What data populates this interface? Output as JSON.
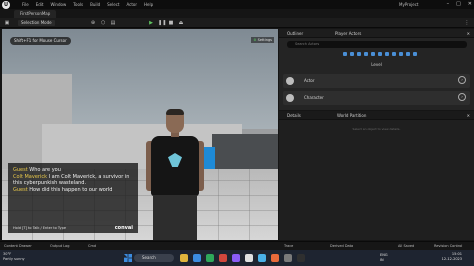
{
  "window": {
    "menu": [
      "File",
      "Edit",
      "Window",
      "Tools",
      "Build",
      "Select",
      "Actor",
      "Help"
    ],
    "project": "MyProject",
    "map_tab": "FirstPersonMap"
  },
  "toolbar": {
    "selection_mode": "Selection Mode"
  },
  "viewport": {
    "top_badge": "Shift+F1 for Mouse Cursor",
    "settings": "Settings",
    "chat": [
      {
        "speaker": "Guest",
        "text": "Who are you"
      },
      {
        "speaker": "Colt Maverick",
        "text": "I am Colt Maverick, a survivor in this cyberpunkish wasteland."
      },
      {
        "speaker": "Guest",
        "text": "How did this happen to our world"
      }
    ],
    "hold_hint": "Hold [T] to Talk / Enter to Type",
    "brand": "convai"
  },
  "outliner": {
    "tabs": [
      "Outliner",
      "Player Actors"
    ],
    "search_placeholder": "Search Actors",
    "level": "Level",
    "rows": [
      "Actor",
      "Character"
    ]
  },
  "details": {
    "tabs": [
      "Details",
      "World Partition"
    ],
    "empty_text": "Select an object to view details."
  },
  "drawer": {
    "items": [
      "Content Drawer",
      "Output Log",
      "Cmd",
      "Trace",
      "Derived Data",
      "All Saved",
      "Revision Control"
    ]
  },
  "taskbar": {
    "weather_temp": "30°F",
    "weather_desc": "Partly sunny",
    "search": "Search",
    "lang": "ENG",
    "region": "IN",
    "time": "15:01",
    "date": "12-12-2023",
    "app_colors": [
      "#e0b43c",
      "#3c8ce0",
      "#2fa85a",
      "#d2473c",
      "#8b5cf6",
      "#e0e0e0",
      "#4ab1e8",
      "#e86a3a",
      "#7a7a7a",
      "#2f2f2f"
    ]
  }
}
